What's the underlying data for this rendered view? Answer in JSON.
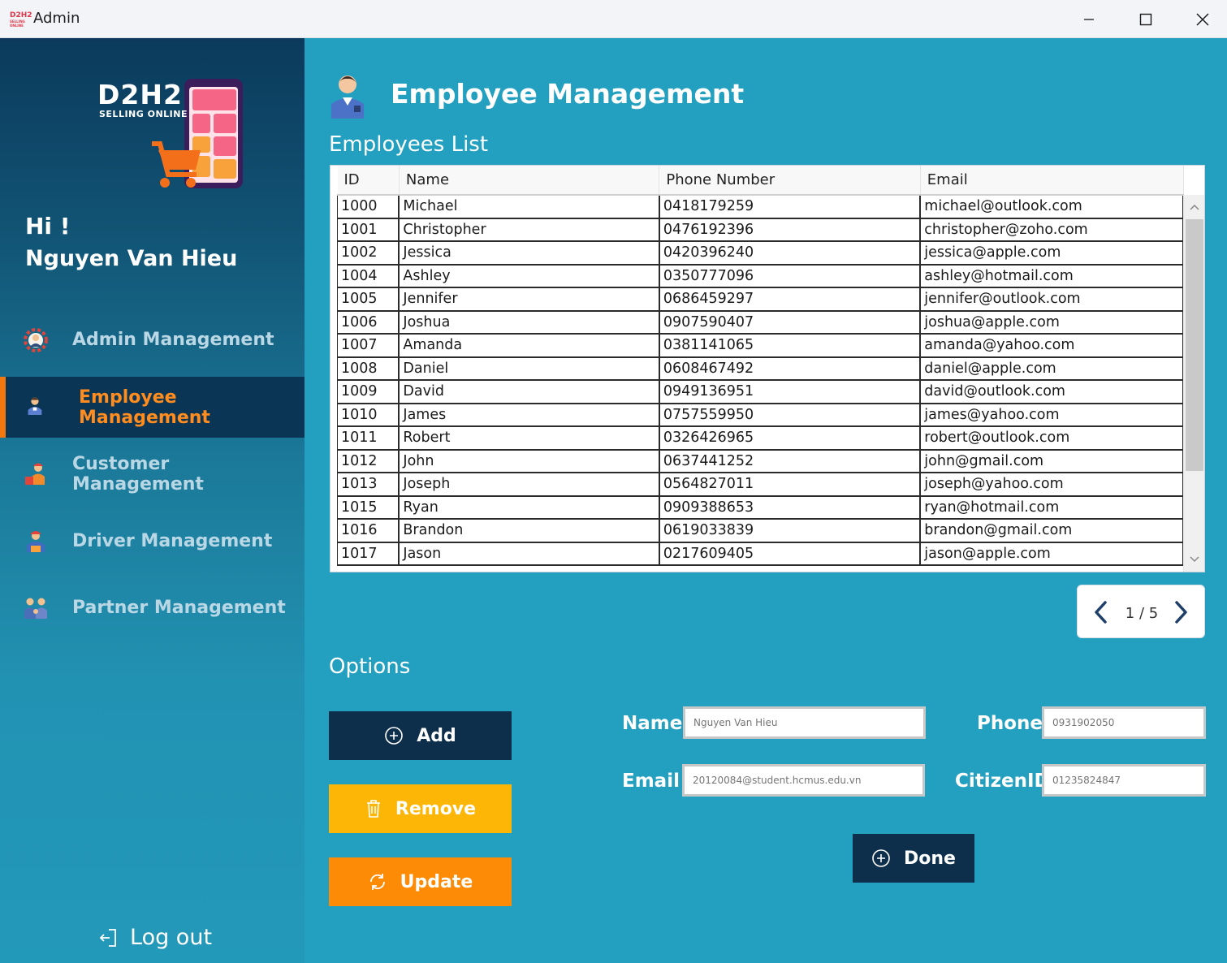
{
  "window": {
    "title": "Admin",
    "icon_text": "D2H2",
    "icon_sub": "SELLING ONLINE"
  },
  "sidebar": {
    "logo_title": "D2H2",
    "logo_subtitle": "SELLING ONLINE",
    "greeting": "Hi !",
    "user_name": "Nguyen Van Hieu",
    "items": [
      {
        "label": "Admin Management",
        "icon": "gear-admin-icon"
      },
      {
        "label": "Employee Management",
        "icon": "employee-icon",
        "active": true
      },
      {
        "label": "Customer Management",
        "icon": "customer-icon"
      },
      {
        "label": "Driver Management",
        "icon": "driver-icon"
      },
      {
        "label": "Partner Management",
        "icon": "partner-icon"
      }
    ],
    "logout_label": "Log out"
  },
  "main": {
    "page_title": "Employee Management",
    "list_title": "Employees List",
    "options_title": "Options"
  },
  "table": {
    "columns": [
      "ID",
      "Name",
      "Phone Number",
      "Email"
    ],
    "rows": [
      [
        "1000",
        "Michael",
        "0418179259",
        "michael@outlook.com"
      ],
      [
        "1001",
        "Christopher",
        "0476192396",
        "christopher@zoho.com"
      ],
      [
        "1002",
        "Jessica",
        "0420396240",
        "jessica@apple.com"
      ],
      [
        "1004",
        "Ashley",
        "0350777096",
        "ashley@hotmail.com"
      ],
      [
        "1005",
        "Jennifer",
        "0686459297",
        "jennifer@outlook.com"
      ],
      [
        "1006",
        "Joshua",
        "0907590407",
        "joshua@apple.com"
      ],
      [
        "1007",
        "Amanda",
        "0381141065",
        "amanda@yahoo.com"
      ],
      [
        "1008",
        "Daniel",
        "0608467492",
        "daniel@apple.com"
      ],
      [
        "1009",
        "David",
        "0949136951",
        "david@outlook.com"
      ],
      [
        "1010",
        "James",
        "0757559950",
        "james@yahoo.com"
      ],
      [
        "1011",
        "Robert",
        "0326426965",
        "robert@outlook.com"
      ],
      [
        "1012",
        "John",
        "0637441252",
        "john@gmail.com"
      ],
      [
        "1013",
        "Joseph",
        "0564827011",
        "joseph@yahoo.com"
      ],
      [
        "1015",
        "Ryan",
        "0909388653",
        "ryan@hotmail.com"
      ],
      [
        "1016",
        "Brandon",
        "0619033839",
        "brandon@gmail.com"
      ],
      [
        "1017",
        "Jason",
        "0217609405",
        "jason@apple.com"
      ]
    ]
  },
  "pager": {
    "text": "1 / 5"
  },
  "buttons": {
    "add": "Add",
    "remove": "Remove",
    "update": "Update",
    "done": "Done"
  },
  "form": {
    "name_label": "Name",
    "name_placeholder": "Nguyen Van Hieu",
    "phone_label": "Phone",
    "phone_placeholder": "0931902050",
    "email_label": "Email",
    "email_placeholder": "20120084@student.hcmus.edu.vn",
    "citizen_label": "CitizenID",
    "citizen_placeholder": "01235824847"
  },
  "colors": {
    "background": "#23a0c0",
    "navy": "#0d2f4b",
    "active_accent": "#f0780f",
    "remove": "#fdb605",
    "update": "#fd8b06"
  }
}
